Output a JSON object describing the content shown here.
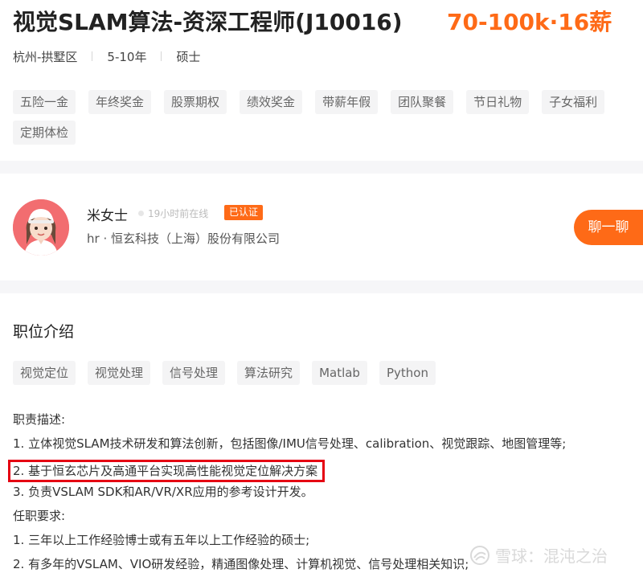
{
  "job": {
    "title": "视觉SLAM算法-资深工程师(J10016)",
    "salary": "70-100k·16薪",
    "location": "杭州-拱墅区",
    "experience": "5-10年",
    "education": "硕士"
  },
  "benefits": [
    "五险一金",
    "年终奖金",
    "股票期权",
    "绩效奖金",
    "带薪年假",
    "团队聚餐",
    "节日礼物",
    "子女福利",
    "定期体检"
  ],
  "recruiter": {
    "name": "米女士",
    "online_status": "19小时前在线",
    "verified_label": "已认证",
    "company": "hr · 恒玄科技（上海）股份有限公司",
    "chat_button": "聊一聊"
  },
  "description": {
    "heading": "职位介绍",
    "skills": [
      "视觉定位",
      "视觉处理",
      "信号处理",
      "算法研究",
      "Matlab",
      "Python"
    ],
    "duties_title": "职责描述:",
    "duties": [
      "1. 立体视觉SLAM技术研发和算法创新，包括图像/IMU信号处理、calibration、视觉跟踪、地图管理等;",
      "2. 基于恒玄芯片及高通平台实现高性能视觉定位解决方案",
      "3. 负责VSLAM SDK和AR/VR/XR应用的参考设计开发。"
    ],
    "requirements_title": "任职要求:",
    "requirements": [
      "1. 三年以上工作经验博士或有五年以上工作经验的硕士;",
      "2. 有多年的VSLAM、VIO研发经验，精通图像处理、计算机视觉、信号处理相关知识;"
    ]
  },
  "watermark": "雪球：混沌之治",
  "colors": {
    "accent": "#fe6a17",
    "highlight_border": "#e50012",
    "tag_bg": "#f4f4f5",
    "divider": "#f6f6f8"
  }
}
